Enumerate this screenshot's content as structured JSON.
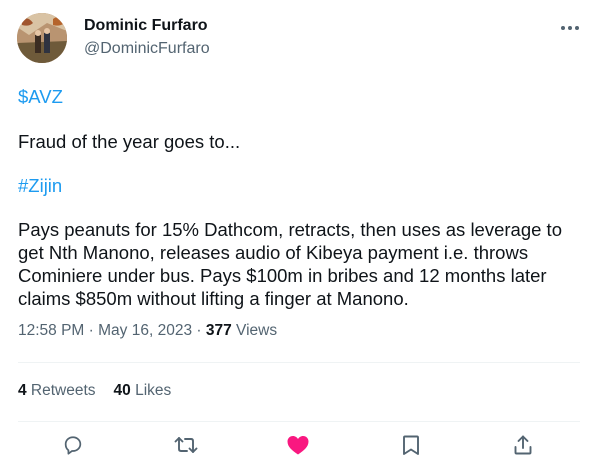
{
  "author": {
    "name": "Dominic Furfaro",
    "handle": "@DominicFurfaro"
  },
  "tweet": {
    "cashtag": "$AVZ",
    "line1": "Fraud of the year goes to...",
    "hashtag": "#Zijin",
    "paragraph": "Pays peanuts for 15% Dathcom, retracts, then uses as leverage to get Nth Manono, releases audio of Kibeya payment i.e. throws Cominiere under bus. Pays $100m in bribes and 12 months later claims $850m without lifting a finger at Manono."
  },
  "meta": {
    "time": "12:58 PM",
    "separator1": " · ",
    "date": "May 16, 2023",
    "separator2": " · ",
    "views_count": "377",
    "views_label": " Views"
  },
  "stats": {
    "retweets_count": "4",
    "retweets_label": " Retweets",
    "likes_count": "40",
    "likes_label": " Likes"
  },
  "colors": {
    "link": "#1d9bf0",
    "secondary_text": "#536471",
    "like_active": "#f91880"
  },
  "icons": {
    "more": "more-horizontal-icon",
    "reply": "reply-icon",
    "retweet": "retweet-icon",
    "like": "heart-filled-icon",
    "bookmark": "bookmark-icon",
    "share": "share-icon"
  }
}
